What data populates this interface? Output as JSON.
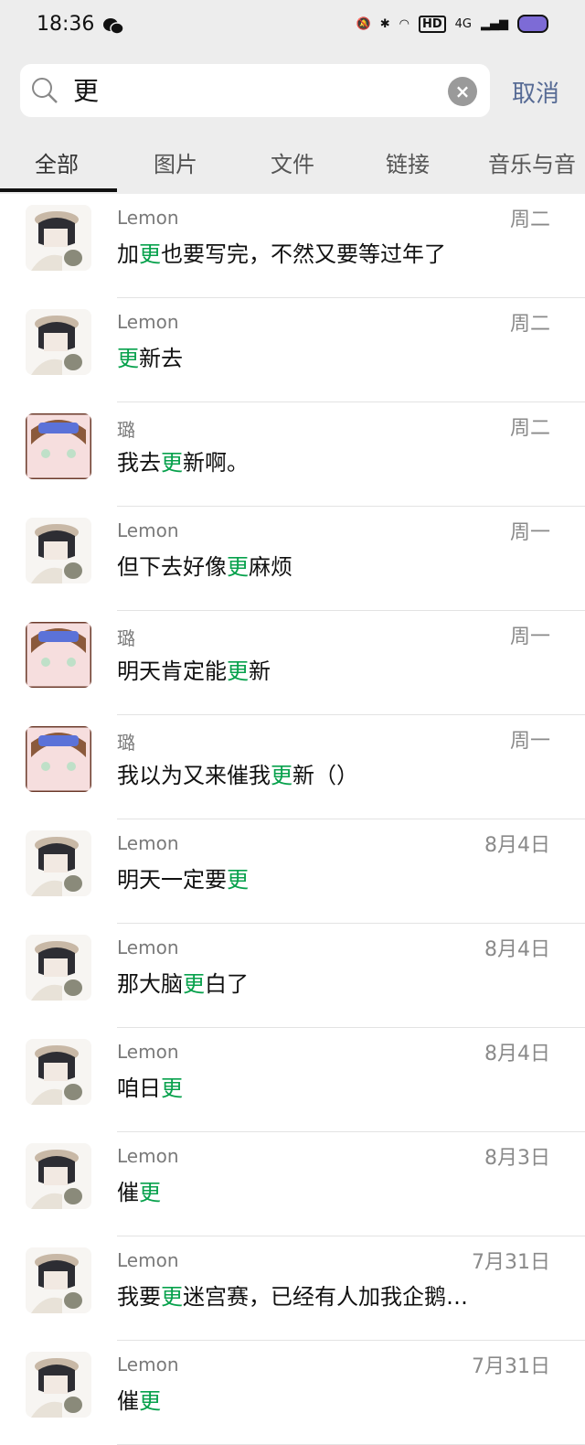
{
  "status": {
    "time": "18:36",
    "network": "4G",
    "hd_badge": "HD"
  },
  "search": {
    "query": "更",
    "cancel_label": "取消"
  },
  "tabs": [
    {
      "label": "全部",
      "active": true
    },
    {
      "label": "图片",
      "active": false
    },
    {
      "label": "文件",
      "active": false
    },
    {
      "label": "链接",
      "active": false
    },
    {
      "label": "音乐与音",
      "active": false
    }
  ],
  "results": [
    {
      "name": "Lemon",
      "date": "周二",
      "pre": "加",
      "hl": "更",
      "post": "也要写完，不然又要等过年了",
      "avatar": "lemon"
    },
    {
      "name": "Lemon",
      "date": "周二",
      "pre": "",
      "hl": "更",
      "post": "新去",
      "avatar": "lemon"
    },
    {
      "name": "璐",
      "date": "周二",
      "pre": "我去",
      "hl": "更",
      "post": "新啊。",
      "avatar": "lu"
    },
    {
      "name": "Lemon",
      "date": "周一",
      "pre": "但下去好像",
      "hl": "更",
      "post": "麻烦",
      "avatar": "lemon"
    },
    {
      "name": "璐",
      "date": "周一",
      "pre": "明天肯定能",
      "hl": "更",
      "post": "新",
      "avatar": "lu"
    },
    {
      "name": "璐",
      "date": "周一",
      "pre": "我以为又来催我",
      "hl": "更",
      "post": "新（）",
      "avatar": "lu"
    },
    {
      "name": "Lemon",
      "date": "8月4日",
      "pre": "明天一定要",
      "hl": "更",
      "post": "",
      "avatar": "lemon"
    },
    {
      "name": "Lemon",
      "date": "8月4日",
      "pre": "那大脑",
      "hl": "更",
      "post": "白了",
      "avatar": "lemon"
    },
    {
      "name": "Lemon",
      "date": "8月4日",
      "pre": "咱日",
      "hl": "更",
      "post": "",
      "avatar": "lemon"
    },
    {
      "name": "Lemon",
      "date": "8月3日",
      "pre": "催",
      "hl": "更",
      "post": "",
      "avatar": "lemon"
    },
    {
      "name": "Lemon",
      "date": "7月31日",
      "pre": "我要",
      "hl": "更",
      "post": "迷宫赛，已经有人加我企鹅…",
      "avatar": "lemon"
    },
    {
      "name": "Lemon",
      "date": "7月31日",
      "pre": "催",
      "hl": "更",
      "post": "",
      "avatar": "lemon"
    }
  ],
  "colors": {
    "highlight": "#07a14c",
    "link": "#576b95",
    "header_bg": "#ededed"
  }
}
